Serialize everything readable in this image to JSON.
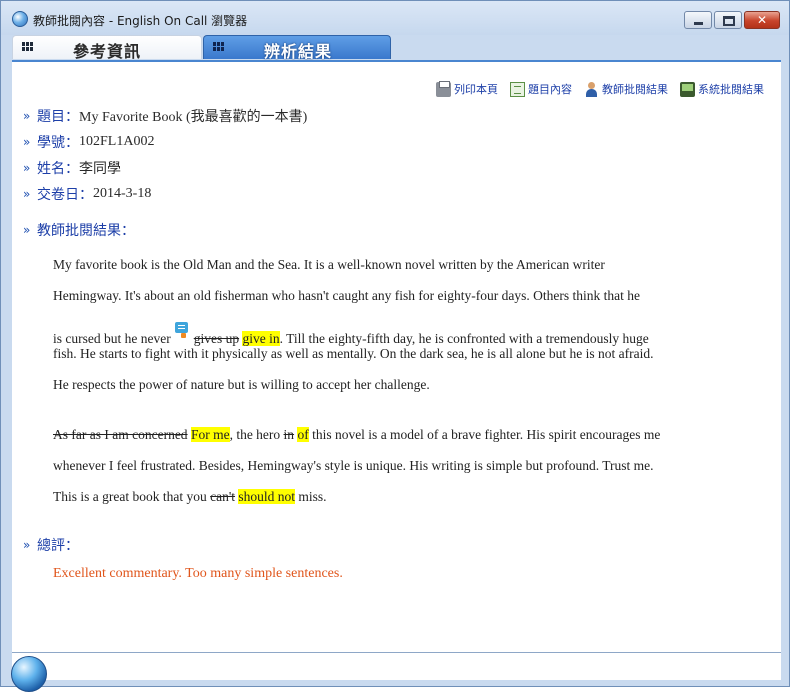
{
  "window": {
    "title": "教師批閱內容 - English On Call 瀏覽器",
    "app_icon": "globe-icon",
    "controls": [
      "minimize-icon",
      "maximize-icon",
      "close-icon"
    ],
    "close_color": "#c8442b"
  },
  "tabs": [
    {
      "label": "參考資訊",
      "active": false
    },
    {
      "label": "辨析結果",
      "active": true
    }
  ],
  "toolbar": {
    "print": "列印本頁",
    "question": "題目內容",
    "teacher_result": "教師批閱結果",
    "system_result": "系統批閱結果"
  },
  "fields": {
    "topic_label": "題目：",
    "topic_value": "My Favorite Book (我最喜歡的一本書)",
    "id_label": "學號：",
    "id_value": "102FL1A002",
    "name_label": "姓名：",
    "name_value": "李同學",
    "date_label": "交卷日：",
    "date_value": "2014-3-18"
  },
  "review": {
    "heading": "教師批閱結果：",
    "p1": {
      "l1": "My favorite book is the Old Man and the Sea. It is a well-known novel written by the American writer",
      "l2": "Hemingway. It's about an old fisherman who hasn't caught any fish for eighty-four days. Others think that he",
      "l3_a": "is cursed but he never",
      "l3_del": "gives up",
      "l3_ins": "give  in",
      "l3_b": ". Till the eighty-fifth day, he is confronted with a tremendously huge",
      "l4": "fish. He starts to fight with it physically as well as mentally. On the dark sea, he is all alone but he is not afraid.",
      "l5": "He respects the power of nature but is willing to accept her challenge."
    },
    "p2": {
      "l1_del1": "As far as I am concerned",
      "l1_ins1": "For me",
      "l1_a": ", the hero",
      "l1_del2": "in",
      "l1_ins2": "of",
      "l1_b": "this novel is a model of a brave fighter. His spirit encourages me",
      "l2": "whenever I feel frustrated. Besides, Hemingway's style is unique. His writing is simple but profound. Trust me.",
      "l3_a": "This is a great book that you",
      "l3_del": "can't",
      "l3_ins": "should not",
      "l3_b": "miss."
    }
  },
  "overall": {
    "heading": "總評：",
    "text": "Excellent commentary. Too many simple sentences.",
    "color": "#e0551b"
  },
  "colors": {
    "highlight": "#ffff00",
    "label_blue": "#1d3fa8",
    "tab_active": "#3a78cc"
  }
}
